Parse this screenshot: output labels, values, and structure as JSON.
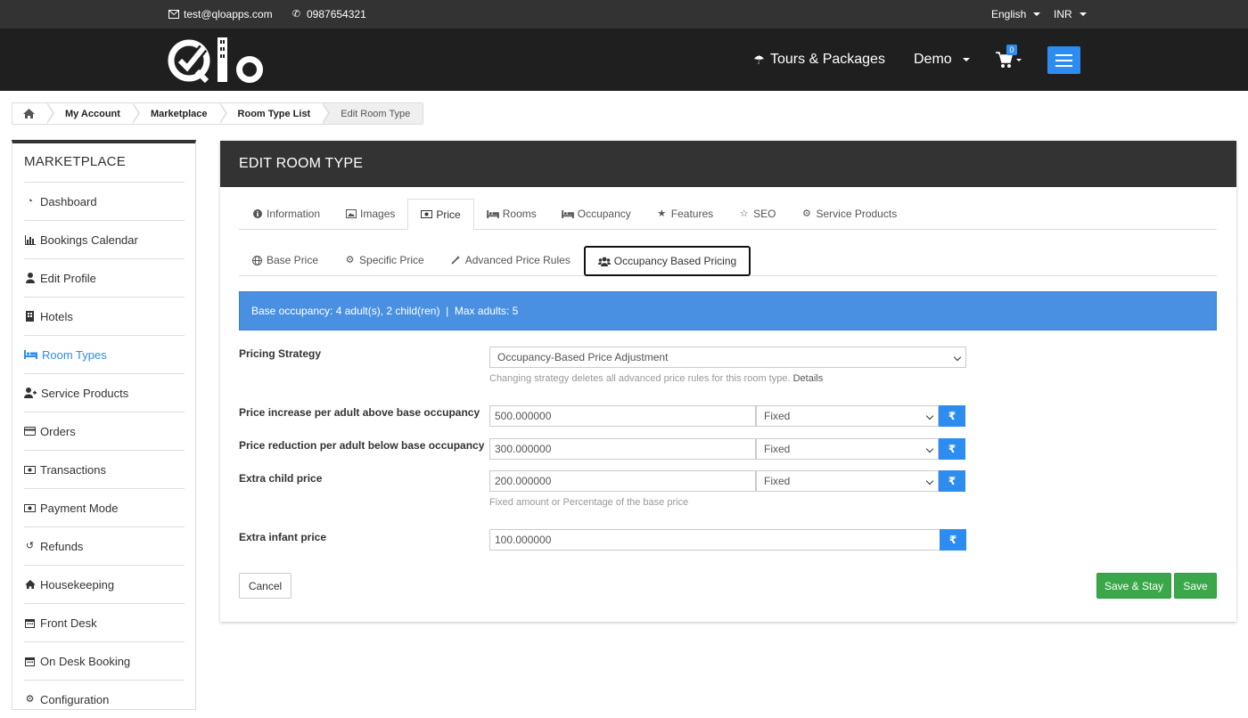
{
  "topbar": {
    "email": "test@qloapps.com",
    "phone": "0987654321",
    "language": "English",
    "currency": "INR"
  },
  "header": {
    "tours_label": "Tours & Packages",
    "account_label": "Demo",
    "cart_count": "0"
  },
  "breadcrumb": {
    "items": [
      "My Account",
      "Marketplace",
      "Room Type List",
      "Edit Room Type"
    ]
  },
  "sidebar": {
    "title": "MARKETPLACE",
    "items": [
      {
        "label": "Dashboard",
        "icon": "dashboard-icon"
      },
      {
        "label": "Bookings Calendar",
        "icon": "bar-chart-icon"
      },
      {
        "label": "Edit Profile",
        "icon": "user-icon"
      },
      {
        "label": "Hotels",
        "icon": "building-icon"
      },
      {
        "label": "Room Types",
        "icon": "bed-icon",
        "active": true
      },
      {
        "label": "Service Products",
        "icon": "user-plus-icon"
      },
      {
        "label": "Orders",
        "icon": "credit-card-icon"
      },
      {
        "label": "Transactions",
        "icon": "money-icon"
      },
      {
        "label": "Payment Mode",
        "icon": "money-icon"
      },
      {
        "label": "Refunds",
        "icon": "undo-icon"
      },
      {
        "label": "Housekeeping",
        "icon": "home-icon"
      },
      {
        "label": "Front Desk",
        "icon": "calendar-icon"
      },
      {
        "label": "On Desk Booking",
        "icon": "calendar-icon"
      },
      {
        "label": "Configuration",
        "icon": "gear-icon"
      }
    ]
  },
  "panel": {
    "title": "EDIT ROOM TYPE",
    "tabs": [
      "Information",
      "Images",
      "Price",
      "Rooms",
      "Occupancy",
      "Features",
      "SEO",
      "Service Products"
    ],
    "subtabs": [
      "Base Price",
      "Specific Price",
      "Advanced Price Rules",
      "Occupancy Based Pricing"
    ],
    "info": "Base occupancy: 4 adult(s), 2 child(ren)  |  Max adults: 5",
    "pricing_strategy": {
      "label": "Pricing Strategy",
      "value": "Occupancy-Based Price Adjustment",
      "help": "Changing strategy deletes all advanced price rules for this room type.",
      "help_link": "Details"
    },
    "fields": [
      {
        "label": "Price increase per adult above base occupancy",
        "value": "500.000000",
        "type": "Fixed"
      },
      {
        "label": "Price reduction per adult below base occupancy",
        "value": "300.000000",
        "type": "Fixed"
      },
      {
        "label": "Extra child price",
        "value": "200.000000",
        "type": "Fixed"
      }
    ],
    "child_help": "Fixed amount or Percentage of the base price",
    "infant": {
      "label": "Extra infant price",
      "value": "100.000000"
    },
    "currency_symbol": "₹",
    "buttons": {
      "cancel": "Cancel",
      "save_stay": "Save & Stay",
      "save": "Save"
    }
  },
  "colors": {
    "accent": "#2d8cf0",
    "success": "#3aa84a",
    "dark": "#333333",
    "info_bar": "#4a90e2"
  }
}
